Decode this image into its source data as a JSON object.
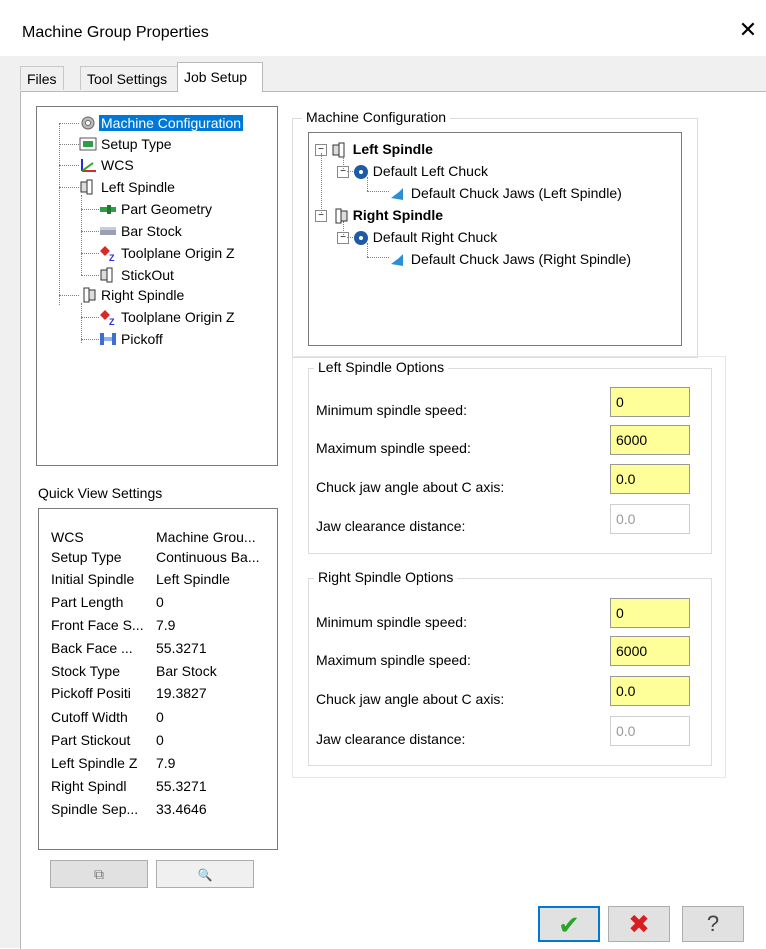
{
  "window": {
    "title": "Machine Group Properties",
    "close_glyph": "✕"
  },
  "tabs": [
    {
      "label": "Files"
    },
    {
      "label": "Tool Settings"
    },
    {
      "label": "Job Setup",
      "active": true
    }
  ],
  "tree": [
    {
      "label": "Machine Configuration",
      "icon": "gear-icon",
      "selected": true
    },
    {
      "label": "Setup Type",
      "icon": "setup-icon"
    },
    {
      "label": "WCS",
      "icon": "axes-icon"
    },
    {
      "label": "Left Spindle",
      "icon": "spindle-icon"
    },
    {
      "label": "Part Geometry",
      "icon": "part-icon"
    },
    {
      "label": "Bar Stock",
      "icon": "bar-stock-icon"
    },
    {
      "label": "Toolplane Origin Z",
      "icon": "toolplane-icon"
    },
    {
      "label": "StickOut",
      "icon": "stickout-icon"
    },
    {
      "label": "Right Spindle",
      "icon": "spindle-icon"
    },
    {
      "label": "Toolplane Origin Z",
      "icon": "toolplane-icon"
    },
    {
      "label": "Pickoff",
      "icon": "pickoff-icon"
    }
  ],
  "quick_view": {
    "label": "Quick View Settings",
    "rows": [
      {
        "key": "WCS",
        "value": "Machine Grou..."
      },
      {
        "key": "Setup Type",
        "value": "Continuous Ba..."
      },
      {
        "key": "Initial Spindle",
        "value": "Left Spindle"
      },
      {
        "key": "Part Length",
        "value": "0"
      },
      {
        "key": "Front Face S...",
        "value": "7.9"
      },
      {
        "key": "Back Face ...",
        "value": "55.3271"
      },
      {
        "key": "Stock Type",
        "value": "Bar Stock"
      },
      {
        "key": "Pickoff Positi",
        "value": "19.3827"
      },
      {
        "key": "Cutoff Width",
        "value": "0"
      },
      {
        "key": "Part Stickout",
        "value": "0"
      },
      {
        "key": "Left Spindle Z",
        "value": "7.9"
      },
      {
        "key": "Right Spindl",
        "value": "55.3271"
      },
      {
        "key": "Spindle Sep...",
        "value": "33.4646"
      }
    ],
    "copy_glyph": "⧉",
    "view_glyph": "🔍"
  },
  "machine_config": {
    "title": "Machine Configuration",
    "nodes": [
      {
        "label": "Left Spindle",
        "bold": true
      },
      {
        "label": "Default Left Chuck"
      },
      {
        "label": "Default Chuck Jaws (Left Spindle)"
      },
      {
        "label": "Right Spindle",
        "bold": true
      },
      {
        "label": "Default Right Chuck"
      },
      {
        "label": "Default Chuck Jaws (Right Spindle)"
      }
    ]
  },
  "left_options": {
    "title": "Left Spindle Options",
    "min_label": "Minimum spindle speed:",
    "min_value": "0",
    "max_label": "Maximum spindle speed:",
    "max_value": "6000",
    "angle_label": "Chuck jaw angle about C axis:",
    "angle_value": "0.0",
    "clear_label": "Jaw clearance distance:",
    "clear_value": "0.0"
  },
  "right_options": {
    "title": "Right Spindle Options",
    "min_label": "Minimum spindle speed:",
    "min_value": "0",
    "max_label": "Maximum spindle speed:",
    "max_value": "6000",
    "angle_label": "Chuck jaw angle about C axis:",
    "angle_value": "0.0",
    "clear_label": "Jaw clearance distance:",
    "clear_value": "0.0"
  },
  "buttons": {
    "ok": "✔",
    "cancel": "✖",
    "help": "?"
  },
  "colors": {
    "field_yellow": "#ffff99",
    "selection_blue": "#0078d7",
    "ok_green": "#2aa52a",
    "cancel_red": "#d81e1e"
  }
}
